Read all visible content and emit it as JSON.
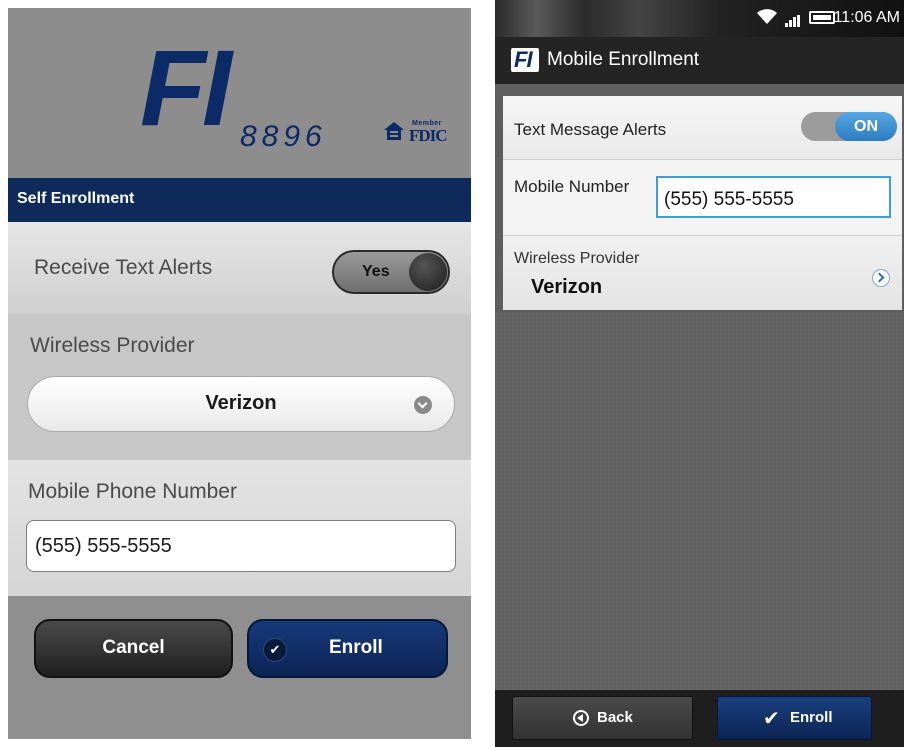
{
  "left_screen": {
    "logo": {
      "letters": "FI",
      "number": "8896"
    },
    "fdic_badge": {
      "member": "Member",
      "name": "FDIC"
    },
    "title": "Self Enrollment",
    "text_alerts": {
      "label": "Receive Text Alerts",
      "toggle_value": "Yes"
    },
    "wireless_provider": {
      "label": "Wireless Provider",
      "selected": "Verizon"
    },
    "mobile_phone": {
      "label": "Mobile Phone Number",
      "value": "(555) 555-5555"
    },
    "buttons": {
      "cancel": "Cancel",
      "enroll": "Enroll",
      "enroll_icon": "✔"
    }
  },
  "right_screen": {
    "status_bar": {
      "time": "11:06 AM",
      "wifi_icon": "wifi-icon",
      "signal_icon": "signal-icon",
      "battery_icon": "battery-icon"
    },
    "action_bar": {
      "logo": "FI",
      "title": "Mobile Enrollment"
    },
    "text_message_alerts": {
      "label": "Text Message Alerts",
      "toggle_value": "ON"
    },
    "mobile_number": {
      "label": "Mobile Number",
      "value": "(555) 555-5555"
    },
    "wireless_provider": {
      "label": "Wireless Provider",
      "value": "Verizon"
    },
    "buttons": {
      "back": "Back",
      "enroll": "Enroll",
      "enroll_icon": "✔"
    }
  },
  "colors": {
    "navy": "#0e2a5b",
    "toggle_on": "#2d7cc4",
    "input_focus": "#39a0d8"
  }
}
